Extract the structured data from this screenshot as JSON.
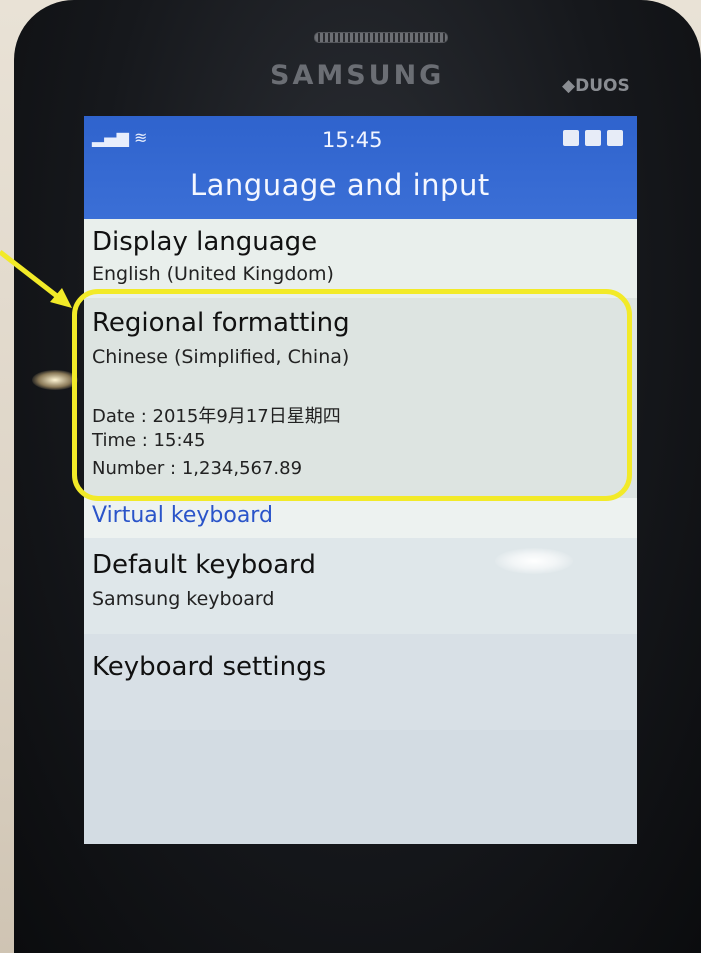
{
  "device": {
    "brand": "SAMSUNG",
    "model_badge": "DUOS"
  },
  "status_bar": {
    "time": "15:45",
    "signal_icon": "signal-icon",
    "wifi_icon": "wifi-icon"
  },
  "header": {
    "title": "Language and input"
  },
  "items": {
    "display_language": {
      "title": "Display language",
      "value": "English (United Kingdom)"
    },
    "regional_formatting": {
      "title": "Regional formatting",
      "value": "Chinese (Simplified, China)",
      "date": "Date : 2015年9月17日星期四",
      "time": "Time : 15:45",
      "number": "Number : 1,234,567.89"
    },
    "virtual_keyboard_section": "Virtual keyboard",
    "default_keyboard": {
      "title": "Default keyboard",
      "value": "Samsung keyboard"
    },
    "keyboard_settings": {
      "title": "Keyboard settings"
    }
  },
  "colors": {
    "header_blue": "#3366d0",
    "section_blue": "#2a54c9",
    "highlight_yellow": "#f2ea28"
  }
}
